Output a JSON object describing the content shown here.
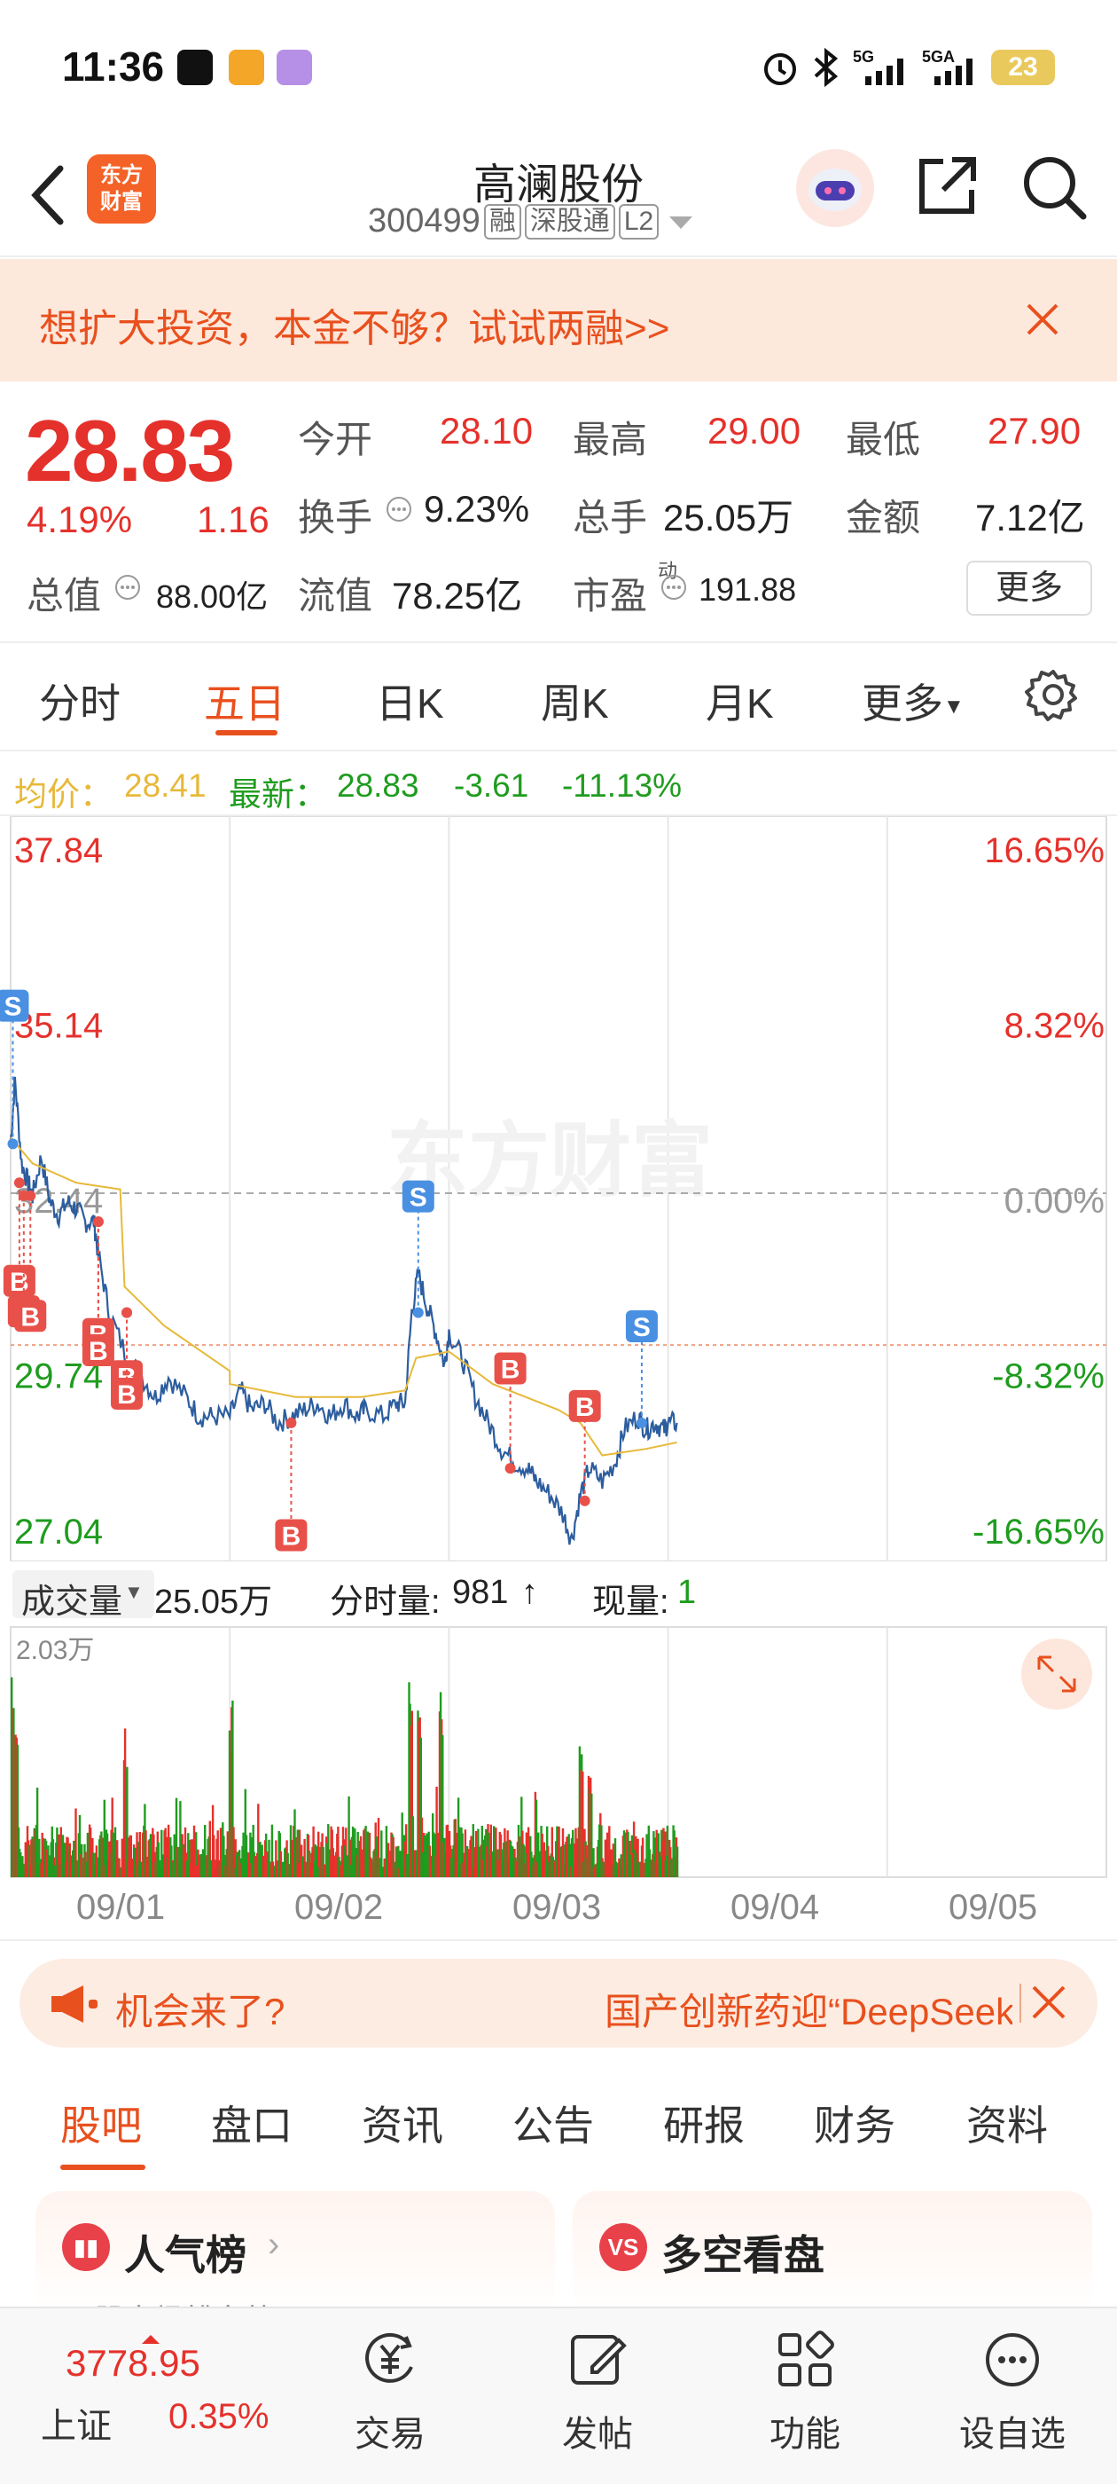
{
  "status_bar": {
    "time": "11:36",
    "battery": "23"
  },
  "header": {
    "logo_text_line1": "东方",
    "logo_text_line2": "财富",
    "stock_name": "高澜股份",
    "stock_code": "300499",
    "tags": [
      "融",
      "深股通",
      "L2"
    ]
  },
  "banner": {
    "text": "想扩大投资，本金不够？试试两融>>"
  },
  "quote": {
    "price": "28.83",
    "change_pct": "4.19%",
    "change_abs": "1.16",
    "open_label": "今开",
    "open": "28.10",
    "high_label": "最高",
    "high": "29.00",
    "low_label": "最低",
    "low": "27.90",
    "turnover_label": "换手",
    "turnover": "9.23%",
    "volume_label": "总手",
    "volume": "25.05万",
    "amount_label": "金额",
    "amount": "7.12亿",
    "mktcap_label": "总值",
    "mktcap": "88.00亿",
    "float_label": "流值",
    "float": "78.25亿",
    "pe_label": "市盈",
    "pe_sup": "动",
    "pe": "191.88",
    "more_button": "更多"
  },
  "chart_tabs": [
    "分时",
    "五日",
    "日K",
    "周K",
    "月K",
    "更多"
  ],
  "chart_info": {
    "avg_label": "均价：",
    "avg": "28.41",
    "latest_label": "最新：",
    "latest": "28.83",
    "chg": "-3.61",
    "chg_pct": "-11.13%"
  },
  "chart_data": {
    "type": "line",
    "y_left_ticks": [
      "37.84",
      "35.14",
      "32.44",
      "29.74",
      "27.04"
    ],
    "y_right_ticks": [
      "16.65%",
      "8.32%",
      "0.00%",
      "-8.32%",
      "-16.65%"
    ],
    "ylim": [
      27.04,
      37.84
    ],
    "baseline": 32.44,
    "x_days": [
      "09/01",
      "09/02",
      "09/03",
      "09/04",
      "09/05"
    ],
    "watermark": "东方财富",
    "price_series": [
      [
        0.0,
        33.2
      ],
      [
        0.02,
        34.2
      ],
      [
        0.05,
        32.9
      ],
      [
        0.08,
        32.6
      ],
      [
        0.1,
        32.4
      ],
      [
        0.14,
        33.0
      ],
      [
        0.18,
        32.3
      ],
      [
        0.22,
        32.1
      ],
      [
        0.26,
        32.3
      ],
      [
        0.3,
        32.2
      ],
      [
        0.34,
        32.0
      ],
      [
        0.38,
        32.0
      ],
      [
        0.4,
        31.5
      ],
      [
        0.45,
        30.6
      ],
      [
        0.52,
        30.0
      ],
      [
        0.6,
        29.6
      ],
      [
        0.66,
        29.3
      ],
      [
        0.72,
        29.6
      ],
      [
        0.8,
        29.3
      ],
      [
        0.86,
        29.0
      ],
      [
        0.92,
        29.0
      ],
      [
        1.0,
        29.0
      ],
      [
        1.05,
        29.4
      ],
      [
        1.1,
        29.1
      ],
      [
        1.16,
        29.2
      ],
      [
        1.22,
        28.9
      ],
      [
        1.28,
        29.0
      ],
      [
        1.34,
        29.1
      ],
      [
        1.4,
        29.2
      ],
      [
        1.46,
        29.0
      ],
      [
        1.52,
        29.2
      ],
      [
        1.58,
        29.0
      ],
      [
        1.62,
        29.1
      ],
      [
        1.7,
        29.0
      ],
      [
        1.76,
        29.2
      ],
      [
        1.8,
        29.2
      ],
      [
        1.83,
        30.6
      ],
      [
        1.86,
        31.2
      ],
      [
        1.9,
        30.7
      ],
      [
        1.94,
        30.3
      ],
      [
        1.98,
        29.8
      ],
      [
        2.0,
        30.3
      ],
      [
        2.06,
        29.9
      ],
      [
        2.12,
        29.3
      ],
      [
        2.18,
        28.9
      ],
      [
        2.24,
        28.5
      ],
      [
        2.3,
        28.3
      ],
      [
        2.36,
        28.2
      ],
      [
        2.4,
        28.0
      ],
      [
        2.46,
        27.8
      ],
      [
        2.52,
        27.5
      ],
      [
        2.56,
        27.1
      ],
      [
        2.6,
        27.8
      ],
      [
        2.64,
        28.2
      ],
      [
        2.7,
        28.0
      ],
      [
        2.76,
        28.3
      ],
      [
        2.8,
        28.8
      ],
      [
        2.86,
        29.0
      ],
      [
        2.9,
        28.8
      ],
      [
        2.94,
        28.9
      ],
      [
        2.98,
        28.8
      ],
      [
        3.0,
        28.9
      ],
      [
        3.04,
        28.9
      ]
    ],
    "avg_series": [
      [
        0.0,
        33.3
      ],
      [
        0.1,
        32.9
      ],
      [
        0.3,
        32.6
      ],
      [
        0.5,
        32.5
      ],
      [
        0.52,
        31.0
      ],
      [
        0.7,
        30.4
      ],
      [
        1.0,
        29.7
      ],
      [
        1.0,
        29.5
      ],
      [
        1.3,
        29.3
      ],
      [
        1.6,
        29.3
      ],
      [
        1.8,
        29.4
      ],
      [
        1.85,
        29.9
      ],
      [
        2.0,
        30.0
      ],
      [
        2.2,
        29.5
      ],
      [
        2.5,
        29.1
      ],
      [
        2.6,
        28.9
      ],
      [
        2.7,
        28.4
      ],
      [
        2.9,
        28.5
      ],
      [
        3.04,
        28.6
      ]
    ],
    "trade_markers": [
      {
        "t": "S",
        "x": 0.01,
        "price": 33.2,
        "label_y": 35.33
      },
      {
        "t": "B",
        "x": 0.04,
        "price": 32.6,
        "label_y": 31.09
      },
      {
        "t": "B",
        "x": 0.06,
        "price": 32.4,
        "label_y": 30.62
      },
      {
        "t": "B",
        "x": 0.09,
        "price": 32.4,
        "label_y": 30.55
      },
      {
        "t": "B",
        "x": 0.4,
        "price": 32.0,
        "label_y": 30.27
      },
      {
        "t": "B",
        "x": 0.4,
        "price": 32.0,
        "label_y": 30.02
      },
      {
        "t": "B",
        "x": 0.53,
        "price": 30.6,
        "label_y": 29.62
      },
      {
        "t": "B",
        "x": 0.53,
        "price": 30.6,
        "label_y": 29.35
      },
      {
        "t": "B",
        "x": 1.28,
        "price": 28.9,
        "label_y": 27.17
      },
      {
        "t": "S",
        "x": 1.86,
        "price": 30.6,
        "label_y": 32.39
      },
      {
        "t": "B",
        "x": 2.28,
        "price": 28.2,
        "label_y": 29.74
      },
      {
        "t": "B",
        "x": 2.62,
        "price": 27.7,
        "label_y": 29.16
      },
      {
        "t": "S",
        "x": 2.88,
        "price": 28.9,
        "label_y": 30.39
      }
    ],
    "volume_max_label": "2.03万"
  },
  "volume_bar": {
    "label": "成交量",
    "total": "25.05万",
    "timeshare_label": "分时量:",
    "timeshare": "981",
    "current_label": "现量:",
    "current": "1"
  },
  "promo": {
    "left": "机会来了?",
    "right": "国产创新药迎“DeepSeek时刻”"
  },
  "sub_tabs": [
    "股吧",
    "盘口",
    "资讯",
    "公告",
    "研报",
    "财务",
    "资料"
  ],
  "cards": [
    {
      "title": "人气榜",
      "sub": "A股市场排名第",
      "icon": "▮▮"
    },
    {
      "title": "多空看盘",
      "sub": "",
      "icon": "VS"
    }
  ],
  "bottom_nav": {
    "index_value": "3778.95",
    "index_name": "上证",
    "index_pct": "0.35%",
    "items": [
      "交易",
      "发帖",
      "功能",
      "设自选"
    ]
  },
  "colors": {
    "up": "#e5312b",
    "down": "#1f9c1f",
    "accent": "#e8501e",
    "line": "#2c5d9e",
    "avg": "#e7b93a"
  }
}
